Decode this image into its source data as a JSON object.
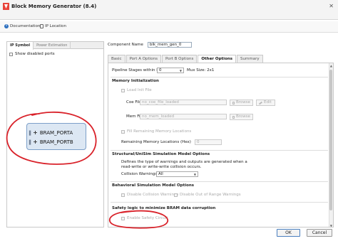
{
  "window": {
    "title": "Block Memory Generator (8.4)",
    "close_glyph": "✕"
  },
  "toolbar": {
    "documentation_label": "Documentation",
    "ip_location_label": "IP Location"
  },
  "left_panel": {
    "tabs": [
      {
        "label": "IP Symbol",
        "active": true
      },
      {
        "label": "Power Estimation",
        "active": false
      }
    ],
    "show_disabled_ports_label": "Show disabled ports",
    "ports": [
      {
        "label": "BRAM_PORTA"
      },
      {
        "label": "BRAM_PORTB"
      }
    ],
    "port_bars_glyph": "||",
    "port_plus_glyph": "+"
  },
  "right_panel": {
    "component_name_label": "Component Name",
    "component_name_value": "blk_mem_gen_0",
    "tabs": [
      {
        "label": "Basic",
        "active": false
      },
      {
        "label": "Port A Options",
        "active": false
      },
      {
        "label": "Port B Options",
        "active": false
      },
      {
        "label": "Other Options",
        "active": true
      },
      {
        "label": "Summary",
        "active": false
      }
    ],
    "pipeline": {
      "label": "Pipeline Stages within Mux",
      "value": "0",
      "mux_size_label": "Mux Size: 2x1"
    },
    "memory_init": {
      "title": "Memory Initialization",
      "load_init_file_label": "Load Init File",
      "coe_file_label": "Coe File",
      "coe_file_value": "no_coe_file_loaded",
      "mem_file_label": "Mem File",
      "mem_file_value": "no_mem_loaded",
      "browse_label": "Browse",
      "edit_label": "Edit",
      "fill_remaining_label": "Fill Remaining Memory Locations",
      "remaining_label": "Remaining Memory Locations (Hex)",
      "remaining_value": "0"
    },
    "structural": {
      "title": "Structural/UniSim Simulation Model Options",
      "description_line1": "Defines the type of warnings and outputs are generated when a",
      "description_line2": "read-write or write-write collision occurs.",
      "collision_label": "Collision Warnings",
      "collision_value": "All"
    },
    "behavioral": {
      "title": "Behavioral Simulation Model Options",
      "disable_collision_label": "Disable Collision Warnings",
      "disable_out_of_range_label": "Disable Out of Range Warnings"
    },
    "safety": {
      "title": "Safety logic to minimize BRAM data corruption",
      "enable_label": "Enable Safety Circuit"
    }
  },
  "footer": {
    "ok_label": "OK",
    "cancel_label": "Cancel"
  },
  "colors": {
    "annotation_red": "#d9222a",
    "symbol_fill": "#dce7f3",
    "symbol_border": "#7c9fc8"
  }
}
